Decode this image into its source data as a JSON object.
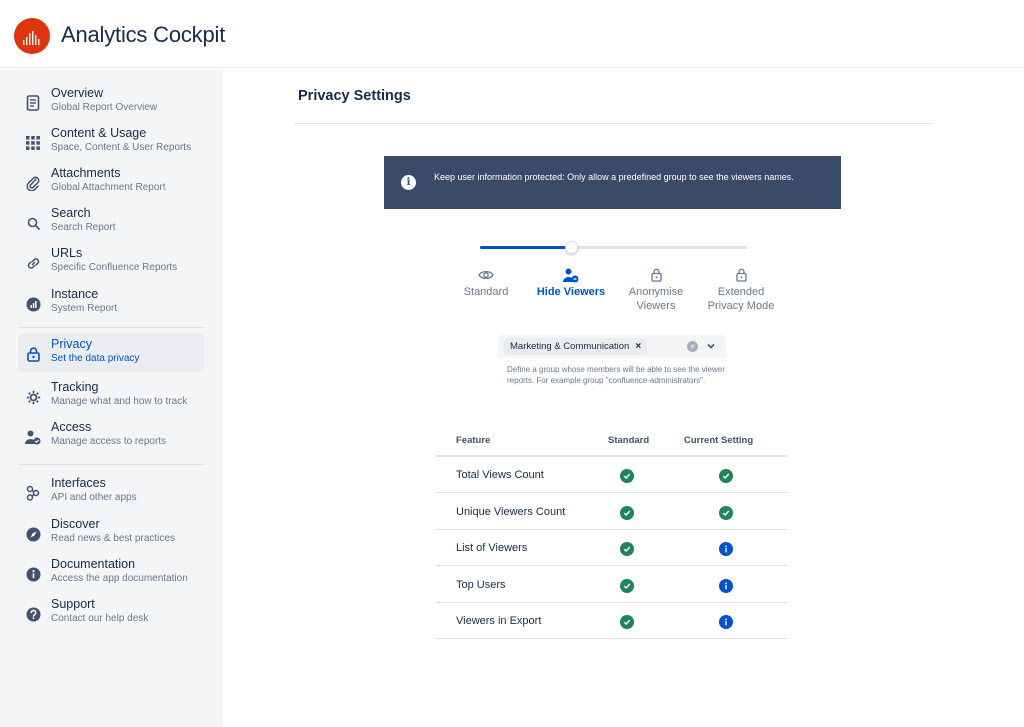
{
  "app": {
    "title": "Analytics Cockpit",
    "logo_icon": "analytics-logo"
  },
  "sidebar": {
    "items": [
      {
        "title": "Overview",
        "subtitle": "Global Report Overview",
        "icon": "document-icon"
      },
      {
        "title": "Content & Usage",
        "subtitle": "Space, Content & User Reports",
        "icon": "grid-icon"
      },
      {
        "title": "Attachments",
        "subtitle": "Global Attachment Report",
        "icon": "paperclip-icon"
      },
      {
        "title": "Search",
        "subtitle": "Search Report",
        "icon": "search-icon"
      },
      {
        "title": "URLs",
        "subtitle": "Specific Confluence Reports",
        "icon": "link-icon"
      },
      {
        "title": "Instance",
        "subtitle": "System Report",
        "icon": "instance-icon"
      },
      {
        "title": "Privacy",
        "subtitle": "Set the data privacy",
        "icon": "lock-icon",
        "active": true
      },
      {
        "title": "Tracking",
        "subtitle": "Manage what and how to track",
        "icon": "gear-icon"
      },
      {
        "title": "Access",
        "subtitle": "Manage access to reports",
        "icon": "user-check-icon"
      },
      {
        "title": "Interfaces",
        "subtitle": "API and other apps",
        "icon": "interfaces-icon"
      },
      {
        "title": "Discover",
        "subtitle": "Read news & best practices",
        "icon": "compass-icon"
      },
      {
        "title": "Documentation",
        "subtitle": "Access the app documentation",
        "icon": "info-icon"
      },
      {
        "title": "Support",
        "subtitle": "Contact our help desk",
        "icon": "question-icon"
      }
    ]
  },
  "main": {
    "page_title": "Privacy Settings",
    "banner": {
      "icon": "info-icon",
      "text": "Keep user information protected: Only allow a predefined group to see the viewers names."
    },
    "privacy_slider": {
      "value_fraction": 0.34,
      "levels": [
        {
          "label_line1": "Standard",
          "label_line2": "",
          "icon": "eye-icon"
        },
        {
          "label_line1": "Hide Viewers",
          "label_line2": "",
          "icon": "user-hide-icon",
          "active": true
        },
        {
          "label_line1": "Anonymise",
          "label_line2": "Viewers",
          "icon": "lock-icon"
        },
        {
          "label_line1": "Extended",
          "label_line2": "Privacy Mode",
          "icon": "lock-icon"
        }
      ]
    },
    "group_select": {
      "selected": "Marketing & Communication",
      "remove_glyph": "×",
      "clear_glyph": "×",
      "helper_text": "Define a group whose members will be able to see the viewer reports. For example group \"confluence-administrators\"."
    },
    "feature_table": {
      "headers": {
        "feature": "Feature",
        "standard": "Standard",
        "current": "Current Setting"
      },
      "rows": [
        {
          "feature": "Total Views Count",
          "standard": "check",
          "current": "check"
        },
        {
          "feature": "Unique Viewers Count",
          "standard": "check",
          "current": "check"
        },
        {
          "feature": "List of Viewers",
          "standard": "check",
          "current": "info"
        },
        {
          "feature": "Top Users",
          "standard": "check",
          "current": "info"
        },
        {
          "feature": "Viewers in Export",
          "standard": "check",
          "current": "info"
        }
      ]
    }
  },
  "colors": {
    "accent": "#0052cc",
    "banner_bg": "#3b4a67",
    "success": "#1f845a",
    "logo": "#de350b"
  }
}
